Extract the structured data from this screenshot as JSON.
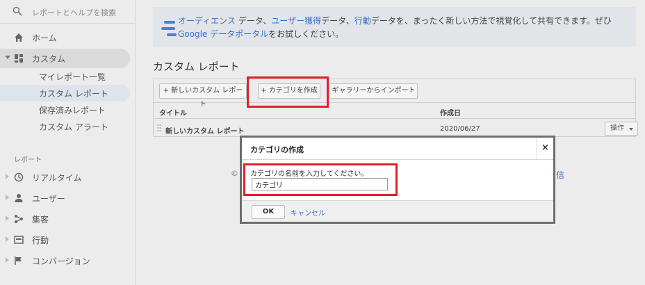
{
  "sidebar": {
    "search_placeholder": "レポートとヘルプを検索",
    "home": "ホーム",
    "customization": "カスタム",
    "sub_items": [
      "マイレポート一覧",
      "カスタム レポート",
      "保存済みレポート",
      "カスタム アラート"
    ],
    "reports_section": "レポート",
    "report_items": [
      "リアルタイム",
      "ユーザー",
      "集客",
      "行動",
      "コンバージョン"
    ]
  },
  "banner": {
    "audience": "オーディエンス",
    "t1": " データ、",
    "acquisition": "ユーザー獲得",
    "t2": "データ、",
    "behavior": "行動",
    "t3": "データを、まったく新しい方法で視覚化して共有できます。ぜひ",
    "data_studio": "Google データポータル",
    "t4": "をお試しください。"
  },
  "main": {
    "title": "カスタム レポート",
    "toolbar": {
      "new_report": "+ 新しいカスタム レポート",
      "create_category": "+ カテゴリを作成",
      "import_gallery": "ギャラリーからインポート"
    },
    "columns": {
      "title": "タイトル",
      "created": "作成日"
    },
    "rows": [
      {
        "title": "新しいカスタム レポート",
        "created": "2020/06/27",
        "action": "操作"
      }
    ],
    "copyright_symbol": "©",
    "feedback_fragment": "信"
  },
  "dialog": {
    "title": "カテゴリの作成",
    "close": "×",
    "label": "カテゴリの名前を入力してください。",
    "input_value": "カテゴリ",
    "ok": "OK",
    "cancel": "キャンセル"
  },
  "colors": {
    "highlight": "#e0202a",
    "link": "#3b6ec1"
  }
}
